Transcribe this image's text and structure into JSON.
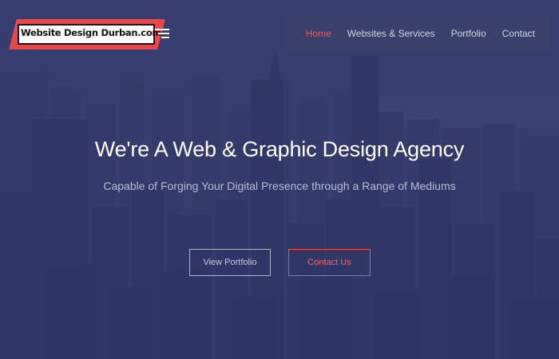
{
  "logo": {
    "text": "Website Design Durban.com",
    "colors": {
      "red": "#e8484c",
      "white": "#ffffff",
      "ink": "#111111"
    }
  },
  "nav": {
    "items": [
      {
        "label": "Home",
        "active": true
      },
      {
        "label": "Websites & Services",
        "active": false
      },
      {
        "label": "Portfolio",
        "active": false
      },
      {
        "label": "Contact",
        "active": false
      }
    ],
    "active_color": "#ef5a5c"
  },
  "hero": {
    "title": "We're A Web & Graphic Design Agency",
    "subtitle": "Capable of Forging Your Digital Presence through a Range of Mediums",
    "background_color": "#3a416f"
  },
  "buttons": {
    "portfolio": "View Portfolio",
    "contact": "Contact Us"
  },
  "colors": {
    "accent": "#ef5457",
    "outline_light": "#aeb3cc"
  }
}
